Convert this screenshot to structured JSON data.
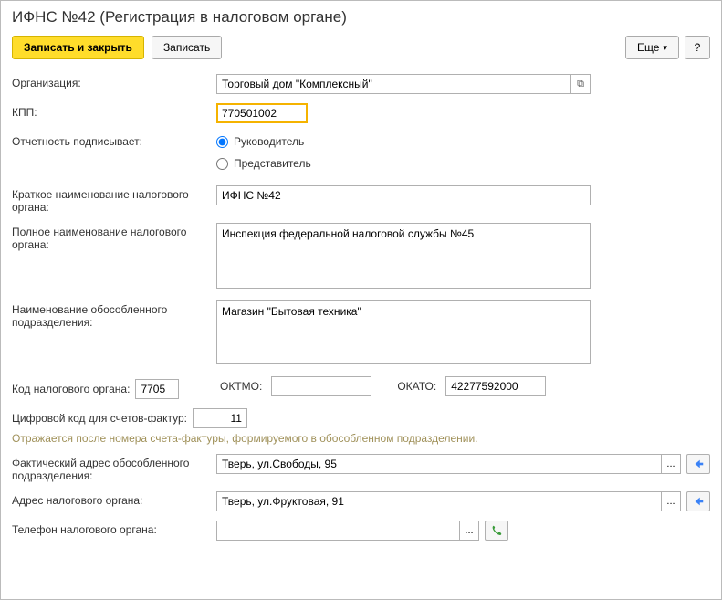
{
  "window": {
    "title": "ИФНС №42 (Регистрация в налоговом органе)"
  },
  "toolbar": {
    "save_close": "Записать и закрыть",
    "save": "Записать",
    "more": "Еще",
    "help": "?"
  },
  "labels": {
    "org": "Организация:",
    "kpp": "КПП:",
    "signer": "Отчетность подписывает:",
    "signer_head": "Руководитель",
    "signer_rep": "Представитель",
    "short_name": "Краткое наименование налогового органа:",
    "full_name": "Полное наименование налогового органа:",
    "subdiv_name": "Наименование обособленного подразделения:",
    "tax_code": "Код налогового органа:",
    "oktmo": "ОКТМО:",
    "okato": "ОКАТО:",
    "digit_code": "Цифровой код для счетов-фактур:",
    "hint": "Отражается после номера счета-фактуры, формируемого в обособленном подразделении.",
    "fact_addr": "Фактический адрес обособленного подразделения:",
    "tax_addr": "Адрес налогового органа:",
    "phone": "Телефон налогового органа:"
  },
  "values": {
    "org": "Торговый дом \"Комплексный\"",
    "kpp": "770501002",
    "short_name": "ИФНС №42",
    "full_name": "Инспекция федеральной налоговой службы №45",
    "subdiv_name": "Магазин \"Бытовая техника\"",
    "tax_code": "7705",
    "oktmo": "",
    "okato": "42277592000",
    "digit_code": "11",
    "fact_addr": "Тверь, ул.Свободы, 95",
    "tax_addr": "Тверь, ул.Фруктовая, 91",
    "phone": ""
  }
}
